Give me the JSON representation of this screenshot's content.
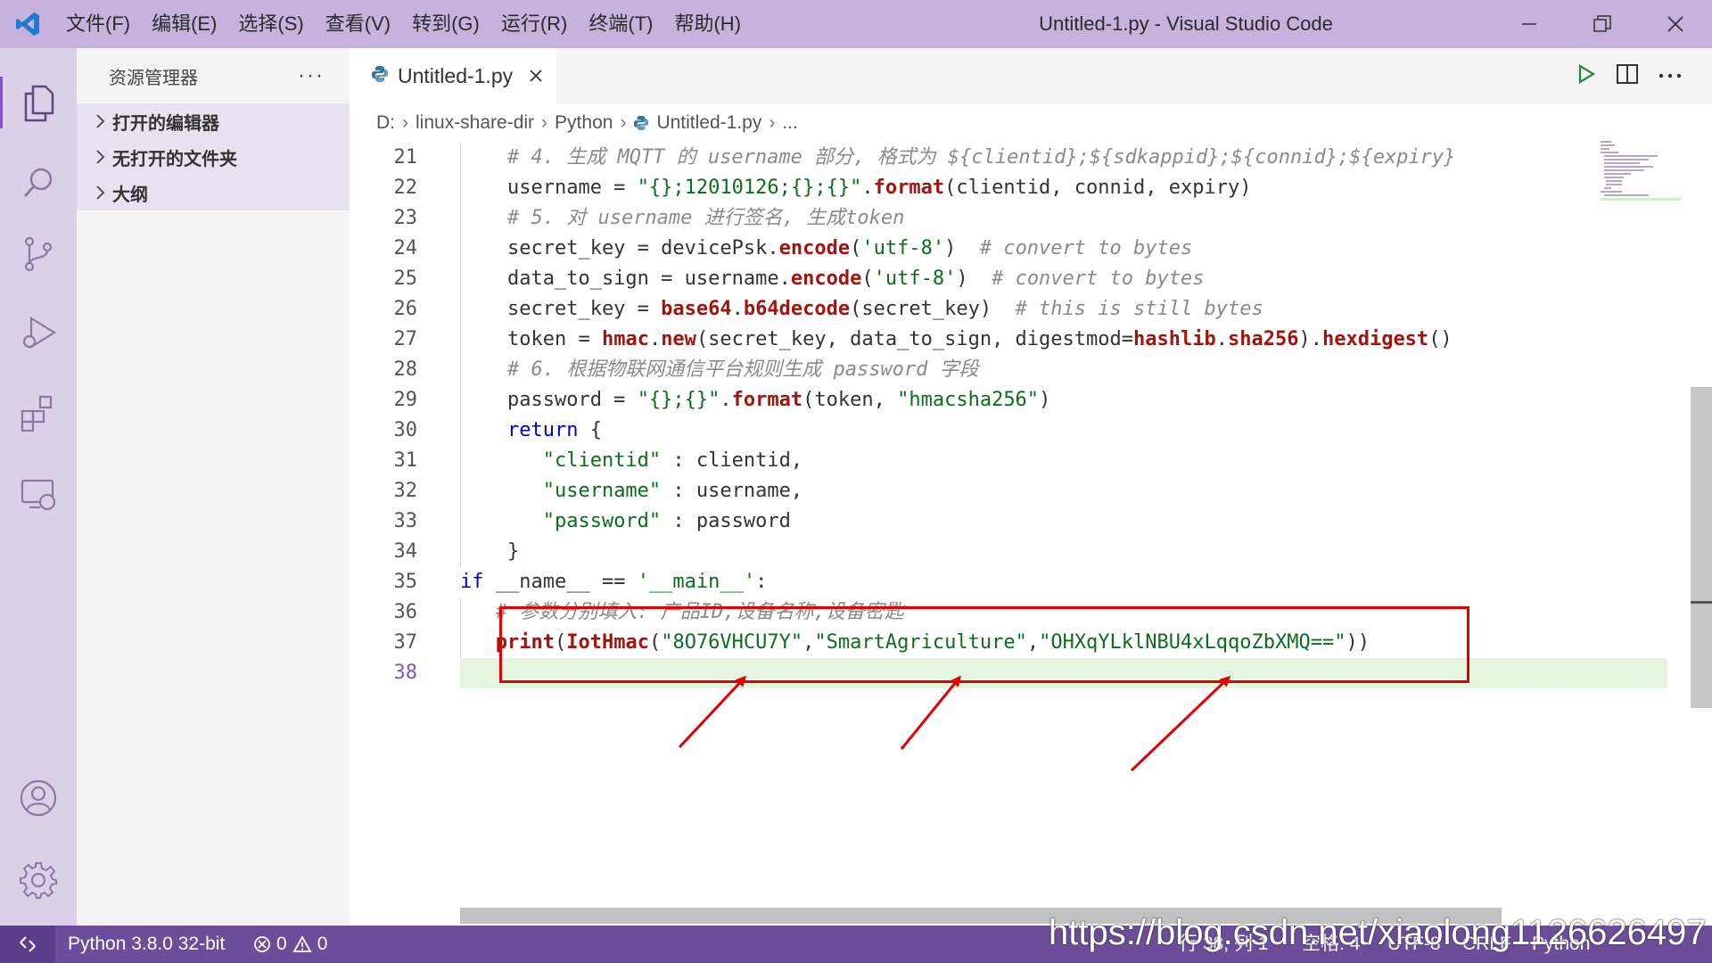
{
  "window": {
    "title": "Untitled-1.py - Visual Studio Code",
    "menu": [
      "文件(F)",
      "编辑(E)",
      "选择(S)",
      "查看(V)",
      "转到(G)",
      "运行(R)",
      "终端(T)",
      "帮助(H)"
    ]
  },
  "sidebar": {
    "title": "资源管理器",
    "more": "···",
    "sections": [
      "打开的编辑器",
      "无打开的文件夹",
      "大纲"
    ]
  },
  "editor": {
    "tab_label": "Untitled-1.py",
    "breadcrumb": [
      "D:",
      "linux-share-dir",
      "Python",
      "Untitled-1.py",
      "..."
    ]
  },
  "code": {
    "lines": [
      {
        "n": "21",
        "indent": "    ",
        "text": "# 4. 生成 MQTT 的 username 部分, 格式为 ${clientid};${sdkappid};${connid};${expiry}"
      },
      {
        "n": "22",
        "indent": "    ",
        "text": "username = \"{};12010126;{};{}\".format(clientid, connid, expiry)"
      },
      {
        "n": "23",
        "indent": "    ",
        "text": "# 5. 对 username 进行签名, 生成token"
      },
      {
        "n": "24",
        "indent": "    ",
        "text": "secret_key = devicePsk.encode('utf-8')  # convert to bytes"
      },
      {
        "n": "25",
        "indent": "    ",
        "text": "data_to_sign = username.encode('utf-8')  # convert to bytes"
      },
      {
        "n": "26",
        "indent": "    ",
        "text": "secret_key = base64.b64decode(secret_key)  # this is still bytes"
      },
      {
        "n": "27",
        "indent": "    ",
        "text": "token = hmac.new(secret_key, data_to_sign, digestmod=hashlib.sha256).hexdigest()"
      },
      {
        "n": "28",
        "indent": "    ",
        "text": "# 6. 根据物联网通信平台规则生成 password 字段"
      },
      {
        "n": "29",
        "indent": "    ",
        "text": "password = \"{};{}\".format(token, \"hmacsha256\")"
      },
      {
        "n": "30",
        "indent": "    ",
        "text": "return {"
      },
      {
        "n": "31",
        "indent": "       ",
        "text": "\"clientid\" : clientid,"
      },
      {
        "n": "32",
        "indent": "       ",
        "text": "\"username\" : username,"
      },
      {
        "n": "33",
        "indent": "       ",
        "text": "\"password\" : password"
      },
      {
        "n": "34",
        "indent": "    ",
        "text": "}"
      },
      {
        "n": "35",
        "indent": "",
        "text": "if __name__ == '__main__':"
      },
      {
        "n": "36",
        "indent": "   ",
        "text": "# 参数分别填入: 产品ID,设备名称,设备密匙"
      },
      {
        "n": "37",
        "indent": "   ",
        "text": "print(IotHmac(\"8O76VHCU7Y\",\"SmartAgriculture\",\"OHXqYLklNBU4xLqqoZbXMQ==\"))"
      },
      {
        "n": "38",
        "indent": "",
        "text": ""
      }
    ]
  },
  "statusbar": {
    "python": "Python 3.8.0 32-bit",
    "errors": "0",
    "warnings": "0",
    "position": "行 38, 列 1",
    "spaces": "空格: 4",
    "encoding": "UTF-8",
    "eol": "CRLF",
    "language": "Python"
  },
  "watermark": "https://blog.csdn.net/xiaolong1126626497",
  "colors": {
    "titlebar": "#c6b2dc",
    "statusbar": "#6b4d99",
    "accent": "#7e57c2",
    "highlight_box": "#e00000"
  }
}
